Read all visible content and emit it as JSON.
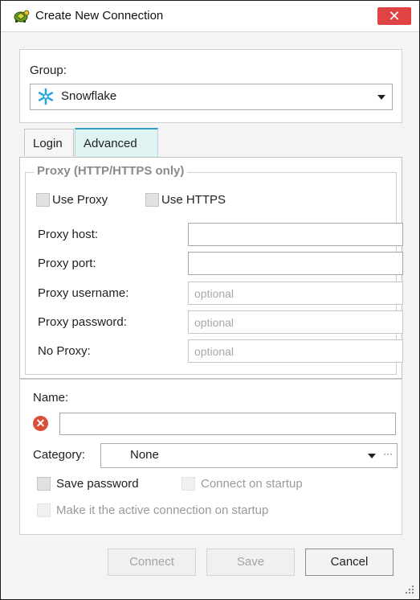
{
  "window": {
    "title": "Create New Connection",
    "close_glyph": "✕",
    "app_icon": "turtle-icon"
  },
  "group": {
    "label": "Group:",
    "selected": "Snowflake",
    "icon": "snowflake-icon"
  },
  "tabs": [
    {
      "label": "Login",
      "active": false
    },
    {
      "label": "Advanced",
      "active": true
    }
  ],
  "proxy": {
    "title": "Proxy (HTTP/HTTPS only)",
    "use_proxy_label": "Use Proxy",
    "use_https_label": "Use HTTPS",
    "fields": [
      {
        "label": "Proxy host:",
        "value": "",
        "placeholder": ""
      },
      {
        "label": "Proxy port:",
        "value": "",
        "placeholder": ""
      },
      {
        "label": "Proxy username:",
        "value": "",
        "placeholder": "optional"
      },
      {
        "label": "Proxy password:",
        "value": "",
        "placeholder": "optional"
      },
      {
        "label": "No Proxy:",
        "value": "",
        "placeholder": "optional"
      }
    ]
  },
  "details": {
    "name_label": "Name:",
    "name_value": "",
    "error_glyph": "✕",
    "category_label": "Category:",
    "category_value": "None",
    "category_more": "···",
    "save_password_label": "Save password",
    "connect_on_startup_label": "Connect on startup",
    "make_active_label": "Make it the active connection on startup"
  },
  "buttons": {
    "connect": "Connect",
    "save": "Save",
    "cancel": "Cancel"
  },
  "colors": {
    "close_red": "#e04343",
    "tab_accent": "#2f9fc3",
    "error_red": "#d94f3a"
  }
}
